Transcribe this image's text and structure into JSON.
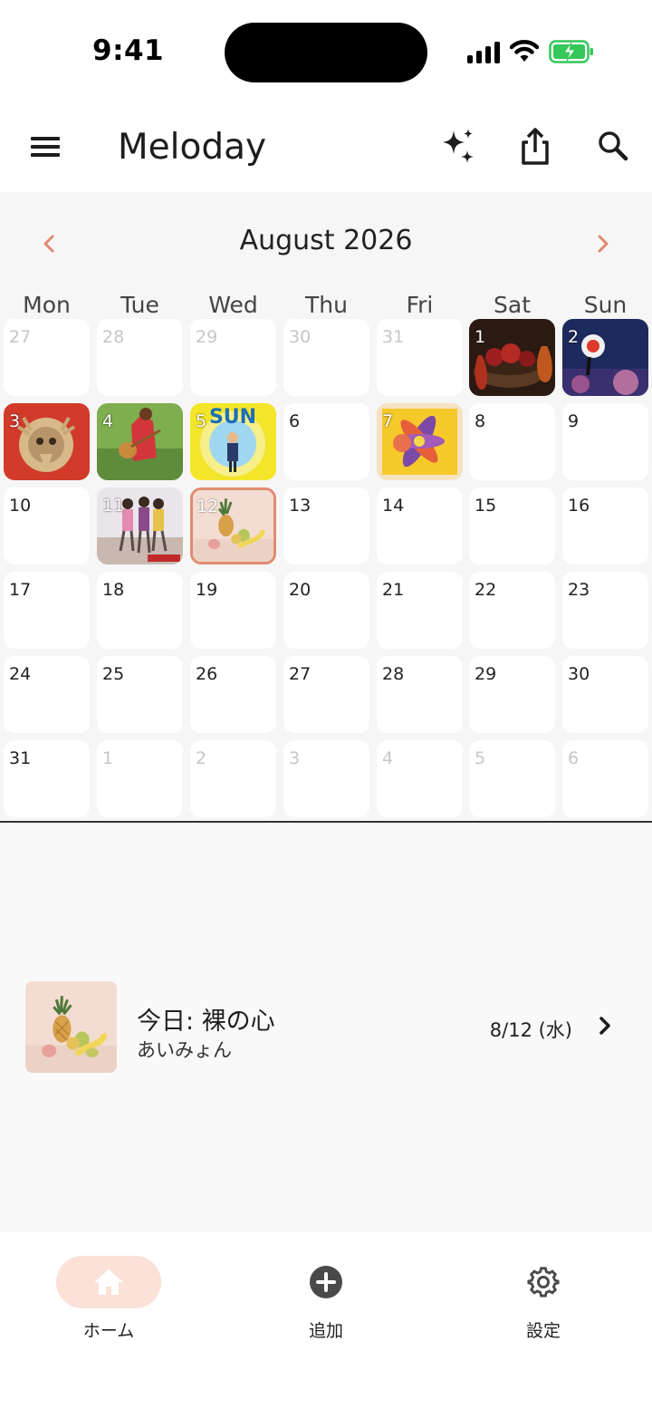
{
  "status_bar": {
    "time": "9:41"
  },
  "app_bar": {
    "title": "Meloday"
  },
  "calendar": {
    "month_label": "August 2026",
    "weekdays": [
      "Mon",
      "Tue",
      "Wed",
      "Thu",
      "Fri",
      "Sat",
      "Sun"
    ],
    "weeks": [
      [
        {
          "day": "27",
          "muted": true
        },
        {
          "day": "28",
          "muted": true
        },
        {
          "day": "29",
          "muted": true
        },
        {
          "day": "30",
          "muted": true
        },
        {
          "day": "31",
          "muted": true
        },
        {
          "day": "1",
          "art": "a1"
        },
        {
          "day": "2",
          "art": "a2"
        }
      ],
      [
        {
          "day": "3",
          "art": "a3"
        },
        {
          "day": "4",
          "art": "a4"
        },
        {
          "day": "5",
          "art": "a5"
        },
        {
          "day": "6"
        },
        {
          "day": "7",
          "art": "a7"
        },
        {
          "day": "8"
        },
        {
          "day": "9"
        }
      ],
      [
        {
          "day": "10"
        },
        {
          "day": "11",
          "art": "a11"
        },
        {
          "day": "12",
          "art": "a12",
          "today": true
        },
        {
          "day": "13"
        },
        {
          "day": "14"
        },
        {
          "day": "15"
        },
        {
          "day": "16"
        }
      ],
      [
        {
          "day": "17"
        },
        {
          "day": "18"
        },
        {
          "day": "19"
        },
        {
          "day": "20"
        },
        {
          "day": "21"
        },
        {
          "day": "22"
        },
        {
          "day": "23"
        }
      ],
      [
        {
          "day": "24"
        },
        {
          "day": "25"
        },
        {
          "day": "26"
        },
        {
          "day": "27"
        },
        {
          "day": "28"
        },
        {
          "day": "29"
        },
        {
          "day": "30"
        }
      ],
      [
        {
          "day": "31"
        },
        {
          "day": "1",
          "muted": true
        },
        {
          "day": "2",
          "muted": true
        },
        {
          "day": "3",
          "muted": true
        },
        {
          "day": "4",
          "muted": true
        },
        {
          "day": "5",
          "muted": true
        },
        {
          "day": "6",
          "muted": true
        }
      ]
    ]
  },
  "today_song": {
    "title": "今日: 裸の心",
    "artist": "あいみょん",
    "date": "8/12 (水)"
  },
  "bottom_nav": {
    "items": [
      {
        "label": "ホーム",
        "icon": "home-icon",
        "active": true
      },
      {
        "label": "追加",
        "icon": "add-circle-icon",
        "active": false
      },
      {
        "label": "設定",
        "icon": "gear-icon",
        "active": false
      }
    ]
  },
  "colors": {
    "accent": "#e08a70",
    "active_pill": "#fbe1d8",
    "calendar_bg": "#f6f6f6"
  }
}
